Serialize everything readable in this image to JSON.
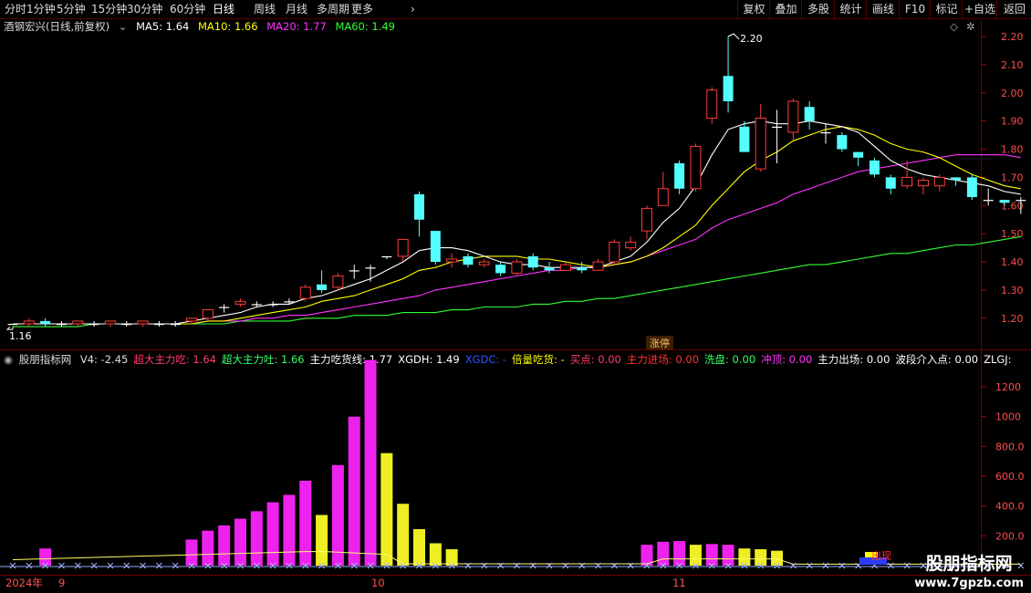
{
  "toolbar": {
    "periods": [
      "分时",
      "1分钟",
      "5分钟",
      "15分钟",
      "30分钟",
      "60分钟",
      "日线",
      "周线",
      "月线",
      "多周期",
      "更多"
    ],
    "active_period": "日线",
    "right_buttons": [
      "复权",
      "叠加",
      "多股",
      "统计",
      "画线",
      "F10",
      "标记",
      "+自选",
      "返回"
    ]
  },
  "main_header": {
    "stock": "酒钢宏兴(日线,前复权)",
    "ma5": "MA5: 1.64",
    "ma10": "MA10: 1.66",
    "ma20": "MA20: 1.77",
    "ma60": "MA60: 1.49"
  },
  "price_axis": {
    "ticks": [
      "2.20",
      "2.10",
      "2.00",
      "1.90",
      "1.80",
      "1.70",
      "1.60",
      "1.50",
      "1.40",
      "1.30",
      "1.20"
    ]
  },
  "annotations": {
    "high": "2.20",
    "low": "1.16",
    "zhangting": "涨停"
  },
  "sub_header": {
    "name": "股朋指标网",
    "items": [
      {
        "text": "V4: -2.45",
        "color": "#dddddd"
      },
      {
        "text": "超大主力吃: 1.64",
        "color": "#ff3b6b"
      },
      {
        "text": "超大主力吐: 1.66",
        "color": "#33ff66"
      },
      {
        "text": "主力吃货线: 1.77",
        "color": "#ffffff"
      },
      {
        "text": "XGDH: 1.49",
        "color": "#ffffff"
      },
      {
        "text": "XGDC: -",
        "color": "#3355ff"
      },
      {
        "text": "倍量吃货: -",
        "color": "#ffff00"
      },
      {
        "text": "买点: 0.00",
        "color": "#ff3b6b"
      },
      {
        "text": "主力进场: 0.00",
        "color": "#ff3333"
      },
      {
        "text": "洗盘: 0.00",
        "color": "#33ff66"
      },
      {
        "text": "冲顶: 0.00",
        "color": "#ff33ff"
      },
      {
        "text": "主力出场: 0.00",
        "color": "#ffffff"
      },
      {
        "text": "波段介入点: 0.00",
        "color": "#ffffff"
      },
      {
        "text": "ZLGJ:",
        "color": "#ffffff"
      }
    ]
  },
  "volume_axis": {
    "ticks": [
      "1200",
      "1000",
      "800.0",
      "600.0",
      "400.0",
      "200.0"
    ]
  },
  "date_axis": {
    "year": "2024年",
    "months": [
      "9",
      "10",
      "11"
    ]
  },
  "signal_label": "出现",
  "watermark": {
    "title": "股朋指标网",
    "url": "www.7gpzb.com"
  },
  "colors": {
    "up": "#ff3b3b",
    "down": "#54ffff",
    "ma5": "#ffffff",
    "ma10": "#ffff00",
    "ma20": "#ff33ff",
    "ma60": "#33ff33",
    "bar_magenta": "#ee22ee",
    "bar_yellow": "#eeee22"
  },
  "chart_data": [
    {
      "type": "candlestick",
      "ylim": [
        1.15,
        2.24
      ],
      "candles": [
        [
          1.18,
          1.18,
          1.17,
          1.16
        ],
        [
          1.18,
          1.19,
          1.2,
          1.17
        ],
        [
          1.19,
          1.18,
          1.2,
          1.17
        ],
        [
          1.18,
          1.18,
          1.19,
          1.17
        ],
        [
          1.18,
          1.19,
          1.19,
          1.17
        ],
        [
          1.18,
          1.18,
          1.19,
          1.17
        ],
        [
          1.18,
          1.19,
          1.19,
          1.17
        ],
        [
          1.18,
          1.18,
          1.19,
          1.17
        ],
        [
          1.18,
          1.19,
          1.19,
          1.17
        ],
        [
          1.18,
          1.18,
          1.19,
          1.17
        ],
        [
          1.18,
          1.18,
          1.19,
          1.17
        ],
        [
          1.19,
          1.2,
          1.2,
          1.18
        ],
        [
          1.2,
          1.23,
          1.23,
          1.19
        ],
        [
          1.24,
          1.24,
          1.25,
          1.22
        ],
        [
          1.25,
          1.26,
          1.27,
          1.24
        ],
        [
          1.25,
          1.25,
          1.26,
          1.24
        ],
        [
          1.25,
          1.25,
          1.26,
          1.24
        ],
        [
          1.26,
          1.26,
          1.27,
          1.25
        ],
        [
          1.27,
          1.31,
          1.32,
          1.26
        ],
        [
          1.32,
          1.3,
          1.37,
          1.29
        ],
        [
          1.31,
          1.35,
          1.36,
          1.3
        ],
        [
          1.37,
          1.37,
          1.39,
          1.34
        ],
        [
          1.38,
          1.38,
          1.39,
          1.33
        ],
        [
          1.42,
          1.42,
          1.42,
          1.41
        ],
        [
          1.42,
          1.48,
          1.48,
          1.4
        ],
        [
          1.64,
          1.55,
          1.65,
          1.49
        ],
        [
          1.51,
          1.4,
          1.51,
          1.39
        ],
        [
          1.4,
          1.41,
          1.43,
          1.38
        ],
        [
          1.42,
          1.39,
          1.43,
          1.38
        ],
        [
          1.39,
          1.4,
          1.41,
          1.38
        ],
        [
          1.39,
          1.36,
          1.4,
          1.35
        ],
        [
          1.36,
          1.4,
          1.41,
          1.35
        ],
        [
          1.42,
          1.38,
          1.43,
          1.37
        ],
        [
          1.38,
          1.37,
          1.4,
          1.36
        ],
        [
          1.37,
          1.39,
          1.4,
          1.37
        ],
        [
          1.38,
          1.37,
          1.4,
          1.36
        ],
        [
          1.37,
          1.4,
          1.41,
          1.37
        ],
        [
          1.4,
          1.47,
          1.48,
          1.39
        ],
        [
          1.45,
          1.47,
          1.49,
          1.44
        ],
        [
          1.51,
          1.59,
          1.6,
          1.48
        ],
        [
          1.6,
          1.66,
          1.72,
          1.6
        ],
        [
          1.75,
          1.66,
          1.76,
          1.64
        ],
        [
          1.66,
          1.81,
          1.82,
          1.65
        ],
        [
          1.91,
          2.01,
          2.02,
          1.89
        ],
        [
          2.06,
          1.97,
          2.2,
          1.93
        ],
        [
          1.88,
          1.79,
          1.9,
          1.79
        ],
        [
          1.73,
          1.91,
          1.96,
          1.72
        ],
        [
          1.88,
          1.88,
          1.94,
          1.75
        ],
        [
          1.86,
          1.97,
          1.98,
          1.83
        ],
        [
          1.95,
          1.9,
          1.97,
          1.87
        ],
        [
          1.86,
          1.86,
          1.89,
          1.82
        ],
        [
          1.85,
          1.8,
          1.86,
          1.79
        ],
        [
          1.79,
          1.77,
          1.79,
          1.74
        ],
        [
          1.76,
          1.71,
          1.77,
          1.7
        ],
        [
          1.7,
          1.66,
          1.71,
          1.64
        ],
        [
          1.67,
          1.7,
          1.76,
          1.66
        ],
        [
          1.67,
          1.69,
          1.7,
          1.64
        ],
        [
          1.67,
          1.7,
          1.71,
          1.65
        ],
        [
          1.7,
          1.69,
          1.7,
          1.67
        ],
        [
          1.7,
          1.63,
          1.71,
          1.62
        ],
        [
          1.62,
          1.62,
          1.66,
          1.6
        ],
        [
          1.62,
          1.61,
          1.62,
          1.6
        ],
        [
          1.62,
          1.62,
          1.63,
          1.57
        ]
      ],
      "ma5": [
        1.18,
        1.18,
        1.18,
        1.18,
        1.18,
        1.18,
        1.18,
        1.18,
        1.18,
        1.18,
        1.18,
        1.19,
        1.2,
        1.21,
        1.22,
        1.24,
        1.25,
        1.25,
        1.27,
        1.28,
        1.3,
        1.32,
        1.34,
        1.37,
        1.4,
        1.44,
        1.45,
        1.45,
        1.44,
        1.42,
        1.4,
        1.39,
        1.39,
        1.38,
        1.38,
        1.38,
        1.38,
        1.4,
        1.42,
        1.47,
        1.54,
        1.59,
        1.67,
        1.78,
        1.87,
        1.89,
        1.9,
        1.89,
        1.89,
        1.9,
        1.89,
        1.88,
        1.86,
        1.81,
        1.76,
        1.73,
        1.71,
        1.7,
        1.69,
        1.68,
        1.67,
        1.65,
        1.64
      ],
      "ma10": [
        1.18,
        1.18,
        1.18,
        1.18,
        1.18,
        1.18,
        1.18,
        1.18,
        1.18,
        1.18,
        1.18,
        1.18,
        1.19,
        1.19,
        1.2,
        1.21,
        1.22,
        1.23,
        1.24,
        1.26,
        1.27,
        1.28,
        1.3,
        1.32,
        1.34,
        1.37,
        1.38,
        1.4,
        1.41,
        1.42,
        1.42,
        1.42,
        1.41,
        1.41,
        1.4,
        1.39,
        1.38,
        1.39,
        1.4,
        1.42,
        1.45,
        1.49,
        1.53,
        1.6,
        1.66,
        1.72,
        1.76,
        1.79,
        1.83,
        1.85,
        1.87,
        1.88,
        1.87,
        1.85,
        1.82,
        1.8,
        1.79,
        1.77,
        1.74,
        1.71,
        1.69,
        1.67,
        1.66
      ],
      "ma20": [
        1.18,
        1.18,
        1.18,
        1.18,
        1.18,
        1.18,
        1.18,
        1.18,
        1.18,
        1.18,
        1.18,
        1.18,
        1.19,
        1.19,
        1.19,
        1.2,
        1.2,
        1.21,
        1.21,
        1.22,
        1.23,
        1.24,
        1.25,
        1.26,
        1.27,
        1.28,
        1.3,
        1.31,
        1.32,
        1.33,
        1.34,
        1.35,
        1.36,
        1.37,
        1.37,
        1.38,
        1.38,
        1.39,
        1.4,
        1.42,
        1.44,
        1.46,
        1.48,
        1.52,
        1.55,
        1.57,
        1.59,
        1.61,
        1.64,
        1.66,
        1.68,
        1.7,
        1.72,
        1.73,
        1.74,
        1.75,
        1.76,
        1.77,
        1.78,
        1.78,
        1.78,
        1.78,
        1.77
      ],
      "ma60": [
        1.17,
        1.17,
        1.17,
        1.17,
        1.17,
        1.18,
        1.18,
        1.18,
        1.18,
        1.18,
        1.18,
        1.18,
        1.18,
        1.18,
        1.19,
        1.19,
        1.19,
        1.19,
        1.2,
        1.2,
        1.2,
        1.21,
        1.21,
        1.21,
        1.22,
        1.22,
        1.22,
        1.23,
        1.23,
        1.24,
        1.24,
        1.24,
        1.25,
        1.25,
        1.26,
        1.26,
        1.27,
        1.27,
        1.28,
        1.29,
        1.3,
        1.31,
        1.32,
        1.33,
        1.34,
        1.35,
        1.36,
        1.37,
        1.38,
        1.39,
        1.39,
        1.4,
        1.41,
        1.42,
        1.43,
        1.43,
        1.44,
        1.45,
        1.46,
        1.46,
        1.47,
        1.48,
        1.49
      ]
    },
    {
      "type": "bar",
      "ylim": [
        80,
        1380
      ],
      "bars": [
        {
          "v": 0,
          "c": "m"
        },
        {
          "v": 0,
          "c": "m"
        },
        {
          "v": 115,
          "c": "m"
        },
        {
          "v": 0,
          "c": "m"
        },
        {
          "v": 0,
          "c": "m"
        },
        {
          "v": 0,
          "c": "m"
        },
        {
          "v": 0,
          "c": "m"
        },
        {
          "v": 0,
          "c": "m"
        },
        {
          "v": 0,
          "c": "m"
        },
        {
          "v": 0,
          "c": "m"
        },
        {
          "v": 0,
          "c": "m"
        },
        {
          "v": 175,
          "c": "m"
        },
        {
          "v": 235,
          "c": "m"
        },
        {
          "v": 270,
          "c": "m"
        },
        {
          "v": 315,
          "c": "m"
        },
        {
          "v": 365,
          "c": "m"
        },
        {
          "v": 425,
          "c": "m"
        },
        {
          "v": 475,
          "c": "m"
        },
        {
          "v": 570,
          "c": "m"
        },
        {
          "v": 340,
          "c": "y"
        },
        {
          "v": 675,
          "c": "m"
        },
        {
          "v": 1000,
          "c": "m"
        },
        {
          "v": 1380,
          "c": "m"
        },
        {
          "v": 755,
          "c": "y"
        },
        {
          "v": 415,
          "c": "y"
        },
        {
          "v": 245,
          "c": "y"
        },
        {
          "v": 150,
          "c": "y"
        },
        {
          "v": 110,
          "c": "y"
        },
        {
          "v": 0,
          "c": "m"
        },
        {
          "v": 0,
          "c": "m"
        },
        {
          "v": 0,
          "c": "m"
        },
        {
          "v": 0,
          "c": "m"
        },
        {
          "v": 0,
          "c": "m"
        },
        {
          "v": 0,
          "c": "m"
        },
        {
          "v": 0,
          "c": "m"
        },
        {
          "v": 0,
          "c": "m"
        },
        {
          "v": 0,
          "c": "m"
        },
        {
          "v": 0,
          "c": "m"
        },
        {
          "v": 0,
          "c": "m"
        },
        {
          "v": 140,
          "c": "m"
        },
        {
          "v": 160,
          "c": "m"
        },
        {
          "v": 165,
          "c": "m"
        },
        {
          "v": 140,
          "c": "y"
        },
        {
          "v": 145,
          "c": "m"
        },
        {
          "v": 140,
          "c": "m"
        },
        {
          "v": 115,
          "c": "y"
        },
        {
          "v": 110,
          "c": "y"
        },
        {
          "v": 100,
          "c": "y"
        },
        {
          "v": 0,
          "c": "m"
        },
        {
          "v": 0,
          "c": "m"
        },
        {
          "v": 0,
          "c": "m"
        },
        {
          "v": 0,
          "c": "m"
        },
        {
          "v": 0,
          "c": "m"
        },
        {
          "v": 0,
          "c": "m"
        },
        {
          "v": 0,
          "c": "m"
        },
        {
          "v": 0,
          "c": "m"
        },
        {
          "v": 0,
          "c": "m"
        },
        {
          "v": 0,
          "c": "m"
        },
        {
          "v": 0,
          "c": "m"
        },
        {
          "v": 0,
          "c": "m"
        },
        {
          "v": 0,
          "c": "m"
        },
        {
          "v": 0,
          "c": "m"
        },
        {
          "v": 0,
          "c": "m"
        }
      ]
    }
  ]
}
